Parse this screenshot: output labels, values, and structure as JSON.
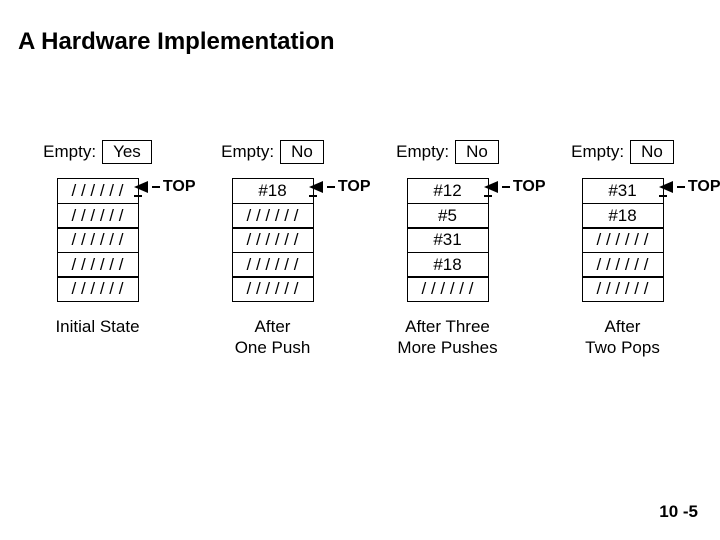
{
  "title": "A Hardware Implementation",
  "empty_label": "Empty:",
  "top_label": "TOP",
  "columns": [
    {
      "empty_value": "Yes",
      "cells": [
        "/ / / / / /",
        "/ / / / / /",
        "/ / / / / /",
        "/ / / / / /",
        "/ / / / / /"
      ],
      "caption": "Initial State",
      "ptr_side": "right"
    },
    {
      "empty_value": "No",
      "cells": [
        "#18",
        "/ / / / / /",
        "/ / / / / /",
        "/ / / / / /",
        "/ / / / / /"
      ],
      "caption": "After\nOne Push",
      "ptr_side": "right"
    },
    {
      "empty_value": "No",
      "cells": [
        "#12",
        "#5",
        "#31",
        "#18",
        "/ / / / / /"
      ],
      "caption": "After Three\nMore Pushes",
      "ptr_side": "right"
    },
    {
      "empty_value": "No",
      "cells": [
        "#31",
        "#18",
        "/ / / / / /",
        "/ / / / / /",
        "/ / / / / /"
      ],
      "caption": "After\nTwo Pops",
      "ptr_side": "right"
    }
  ],
  "slide_number": "10 -5"
}
